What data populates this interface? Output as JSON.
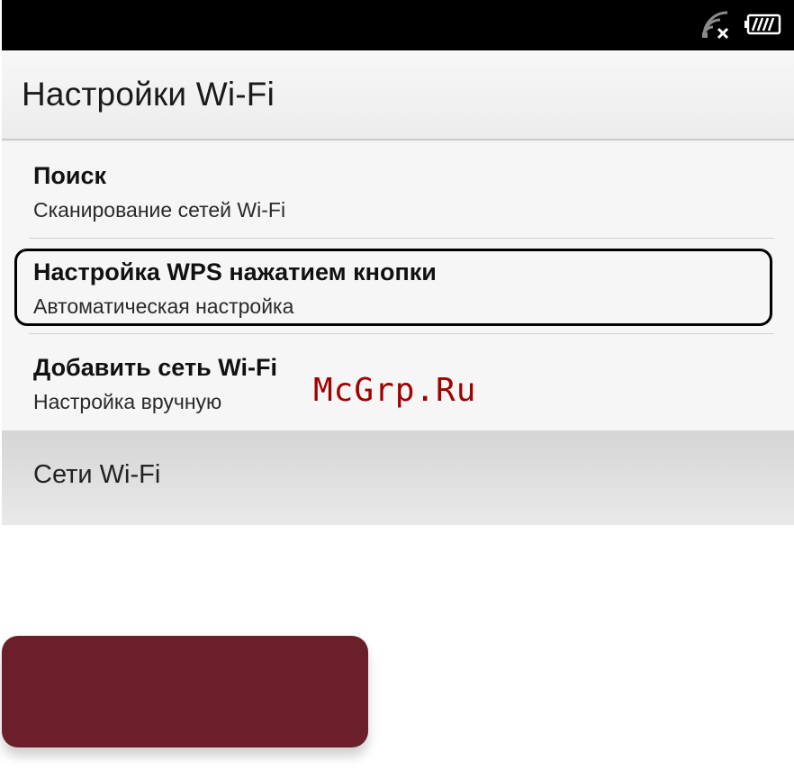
{
  "status_bar": {
    "icons": [
      "wifi-off-icon",
      "battery-icon"
    ]
  },
  "header": {
    "title": "Настройки Wi-Fi"
  },
  "list": {
    "items": [
      {
        "title": "Поиск",
        "subtitle": "Сканирование сетей Wi-Fi"
      },
      {
        "title": "Настройка WPS нажатием кнопки",
        "subtitle": "Автоматическая настройка"
      },
      {
        "title": "Добавить сеть Wi-Fi",
        "subtitle": "Настройка вручную"
      }
    ]
  },
  "section": {
    "label": "Сети Wi-Fi"
  },
  "watermark": "McGrp.Ru",
  "colors": {
    "accent_box": "#6b1f2a",
    "status_bar": "#000000",
    "watermark": "#a00000"
  }
}
